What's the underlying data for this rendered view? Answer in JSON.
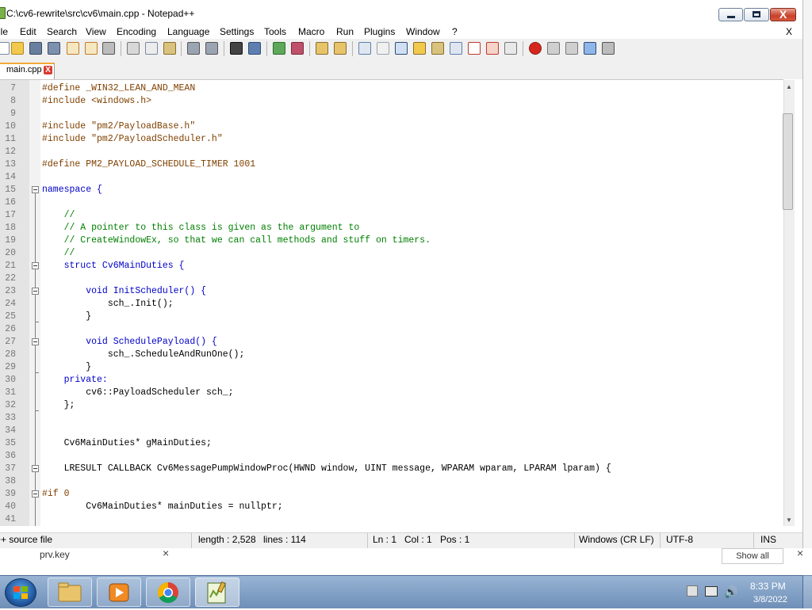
{
  "window": {
    "title": "C:\\cv6-rewrite\\src\\cv6\\main.cpp - Notepad++",
    "close_glyph": "X"
  },
  "menu": {
    "items": [
      "ile",
      "Edit",
      "Search",
      "View",
      "Encoding",
      "Language",
      "Settings",
      "Tools",
      "Macro",
      "Run",
      "Plugins",
      "Window",
      "?"
    ],
    "close_doc": "X"
  },
  "toolbar": {
    "icons": [
      "new-file-icon",
      "open-file-icon",
      "save-icon",
      "save-all-icon",
      "close-icon",
      "close-all-icon",
      "print-icon",
      "cut-icon",
      "copy-icon",
      "paste-icon",
      "undo-icon",
      "redo-icon",
      "find-icon",
      "replace-icon",
      "zoom-in-icon",
      "zoom-out-icon",
      "sync-v-icon",
      "sync-h-icon",
      "word-wrap-icon",
      "show-all-chars-icon",
      "indent-guide-icon",
      "udl-icon",
      "doc-map-icon",
      "function-list-icon",
      "folder-as-workspace-icon",
      "monitoring-icon",
      "record-macro-icon",
      "stop-record-icon",
      "play-macro-icon",
      "run-macro-multiple-icon",
      "save-macro-icon"
    ]
  },
  "tab": {
    "label": "main.cpp",
    "close": "X"
  },
  "editor": {
    "lines": [
      {
        "n": "7",
        "text": "#define _WIN32_LEAN_AND_MEAN"
      },
      {
        "n": "8",
        "text": "#include <windows.h>"
      },
      {
        "n": "9",
        "text": ""
      },
      {
        "n": "10",
        "text": "#include \"pm2/PayloadBase.h\""
      },
      {
        "n": "11",
        "text": "#include \"pm2/PayloadScheduler.h\""
      },
      {
        "n": "12",
        "text": ""
      },
      {
        "n": "13",
        "text": "#define PM2_PAYLOAD_SCHEDULE_TIMER 1001"
      },
      {
        "n": "14",
        "text": ""
      },
      {
        "n": "15",
        "text": "namespace {"
      },
      {
        "n": "16",
        "text": ""
      },
      {
        "n": "17",
        "text": "    //"
      },
      {
        "n": "18",
        "text": "    // A pointer to this class is given as the argument to"
      },
      {
        "n": "19",
        "text": "    // CreateWindowEx, so that we can call methods and stuff on timers."
      },
      {
        "n": "20",
        "text": "    //"
      },
      {
        "n": "21",
        "text": "    struct Cv6MainDuties {"
      },
      {
        "n": "22",
        "text": ""
      },
      {
        "n": "23",
        "text": "        void InitScheduler() {"
      },
      {
        "n": "24",
        "text": "            sch_.Init();"
      },
      {
        "n": "25",
        "text": "        }"
      },
      {
        "n": "26",
        "text": ""
      },
      {
        "n": "27",
        "text": "        void SchedulePayload() {"
      },
      {
        "n": "28",
        "text": "            sch_.ScheduleAndRunOne();"
      },
      {
        "n": "29",
        "text": "        }"
      },
      {
        "n": "30",
        "text": "    private:"
      },
      {
        "n": "31",
        "text": "        cv6::PayloadScheduler sch_;"
      },
      {
        "n": "32",
        "text": "    };"
      },
      {
        "n": "33",
        "text": ""
      },
      {
        "n": "34",
        "text": ""
      },
      {
        "n": "35",
        "text": "    Cv6MainDuties* gMainDuties;"
      },
      {
        "n": "36",
        "text": ""
      },
      {
        "n": "37",
        "text": "    LRESULT CALLBACK Cv6MessagePumpWindowProc(HWND window, UINT message, WPARAM wparam, LPARAM lparam) {"
      },
      {
        "n": "38",
        "text": ""
      },
      {
        "n": "39",
        "text": "#if 0"
      },
      {
        "n": "40",
        "text": "        Cv6MainDuties* mainDuties = nullptr;"
      },
      {
        "n": "41",
        "text": ""
      }
    ]
  },
  "status": {
    "type": "++ source file",
    "length": "length : 2,528",
    "lines": "lines : 114",
    "ln": "Ln : 1",
    "col": "Col : 1",
    "pos": "Pos : 1",
    "eol": "Windows (CR LF)",
    "encoding": "UTF-8",
    "mode": "INS"
  },
  "behind": {
    "file": "prv.key",
    "close": "×",
    "show_all": "Show all"
  },
  "taskbar": {
    "apps": [
      "file-explorer",
      "media-player",
      "chrome",
      "notepad-plus-plus"
    ],
    "time": "8:33 PM",
    "date": "3/8/2022"
  }
}
